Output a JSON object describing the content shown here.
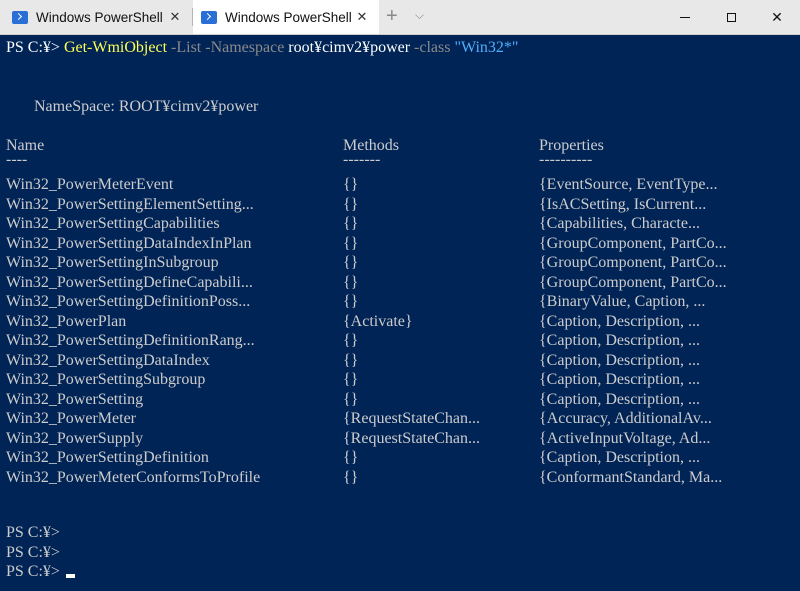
{
  "window": {
    "tabs": [
      {
        "label": "Windows PowerShell",
        "active": false
      },
      {
        "label": "Windows PowerShell",
        "active": true
      }
    ],
    "new_tab_label": "+",
    "dropdown_label": "⌵",
    "close_glyph": "✕"
  },
  "terminal": {
    "command": {
      "prompt": "PS C:¥> ",
      "cmdlet": "Get-WmiObject",
      "p1": " -List",
      "p2": " -Namespace",
      "arg": " root¥cimv2¥power",
      "p3": " -class",
      "str": " \"Win32*\""
    },
    "namespace_line": "NameSpace: ROOT¥cimv2¥power",
    "headers": {
      "name": "Name",
      "methods": "Methods",
      "properties": "Properties"
    },
    "underlines": {
      "name": "----",
      "methods": "-------",
      "properties": "----------"
    },
    "rows": [
      {
        "name": "Win32_PowerMeterEvent",
        "methods": "{}",
        "properties": "{EventSource, EventType..."
      },
      {
        "name": "Win32_PowerSettingElementSetting...",
        "methods": "{}",
        "properties": "{IsACSetting, IsCurrent..."
      },
      {
        "name": "Win32_PowerSettingCapabilities",
        "methods": "{}",
        "properties": "{Capabilities, Characte..."
      },
      {
        "name": "Win32_PowerSettingDataIndexInPlan",
        "methods": "{}",
        "properties": "{GroupComponent, PartCo..."
      },
      {
        "name": "Win32_PowerSettingInSubgroup",
        "methods": "{}",
        "properties": "{GroupComponent, PartCo..."
      },
      {
        "name": "Win32_PowerSettingDefineCapabili...",
        "methods": "{}",
        "properties": "{GroupComponent, PartCo..."
      },
      {
        "name": "Win32_PowerSettingDefinitionPoss...",
        "methods": "{}",
        "properties": "{BinaryValue, Caption, ..."
      },
      {
        "name": "Win32_PowerPlan",
        "methods": "{Activate}",
        "properties": "{Caption, Description, ..."
      },
      {
        "name": "Win32_PowerSettingDefinitionRang...",
        "methods": "{}",
        "properties": "{Caption, Description, ..."
      },
      {
        "name": "Win32_PowerSettingDataIndex",
        "methods": "{}",
        "properties": "{Caption, Description, ..."
      },
      {
        "name": "Win32_PowerSettingSubgroup",
        "methods": "{}",
        "properties": "{Caption, Description, ..."
      },
      {
        "name": "Win32_PowerSetting",
        "methods": "{}",
        "properties": "{Caption, Description, ..."
      },
      {
        "name": "Win32_PowerMeter",
        "methods": "{RequestStateChan...",
        "properties": "{Accuracy, AdditionalAv..."
      },
      {
        "name": "Win32_PowerSupply",
        "methods": "{RequestStateChan...",
        "properties": "{ActiveInputVoltage, Ad..."
      },
      {
        "name": "Win32_PowerSettingDefinition",
        "methods": "{}",
        "properties": "{Caption, Description, ..."
      },
      {
        "name": "Win32_PowerMeterConformsToProfile",
        "methods": "{}",
        "properties": "{ConformantStandard, Ma..."
      }
    ],
    "trailing_prompts": [
      "PS C:¥>",
      "PS C:¥>",
      "PS C:¥>"
    ]
  }
}
